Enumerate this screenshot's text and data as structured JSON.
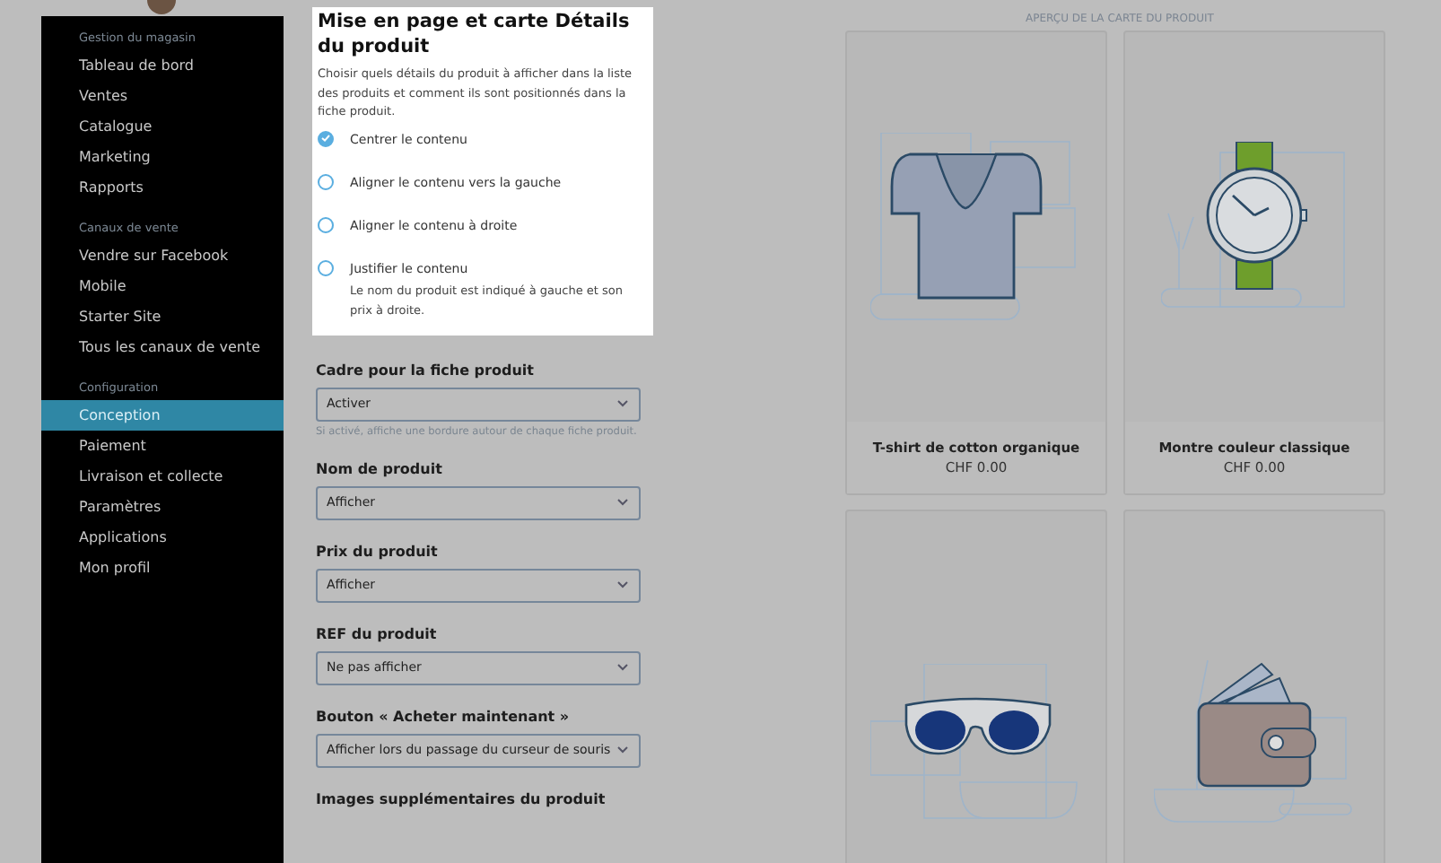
{
  "sidebar": {
    "sections": [
      {
        "heading": "Gestion du magasin",
        "items": [
          {
            "label": "Tableau de bord",
            "selected": false
          },
          {
            "label": "Ventes",
            "selected": false
          },
          {
            "label": "Catalogue",
            "selected": false
          },
          {
            "label": "Marketing",
            "selected": false
          },
          {
            "label": "Rapports",
            "selected": false
          }
        ]
      },
      {
        "heading": "Canaux de vente",
        "items": [
          {
            "label": "Vendre sur Facebook",
            "selected": false
          },
          {
            "label": "Mobile",
            "selected": false
          },
          {
            "label": "Starter Site",
            "selected": false
          },
          {
            "label": "Tous les canaux de vente",
            "selected": false
          }
        ]
      },
      {
        "heading": "Configuration",
        "items": [
          {
            "label": "Conception",
            "selected": true
          },
          {
            "label": "Paiement",
            "selected": false
          },
          {
            "label": "Livraison et collecte",
            "selected": false
          },
          {
            "label": "Paramètres",
            "selected": false
          },
          {
            "label": "Applications",
            "selected": false
          },
          {
            "label": "Mon profil",
            "selected": false
          }
        ]
      }
    ]
  },
  "layout_panel": {
    "title": "Mise en page et carte Détails du produit",
    "description": "Choisir quels détails du produit à afficher dans la liste des produits et comment ils sont positionnés dans la fiche produit.",
    "options": [
      {
        "label": "Centrer le contenu",
        "selected": true
      },
      {
        "label": "Aligner le contenu vers la gauche",
        "selected": false
      },
      {
        "label": "Aligner le contenu à droite",
        "selected": false
      },
      {
        "label": "Justifier le contenu",
        "selected": false,
        "note": "Le nom du produit est indiqué à gauche et son prix à droite."
      }
    ]
  },
  "settings": [
    {
      "label": "Cadre pour la fiche produit",
      "value": "Activer",
      "hint": "Si activé, affiche une bordure autour de chaque fiche produit."
    },
    {
      "label": "Nom de produit",
      "value": "Afficher"
    },
    {
      "label": "Prix du produit",
      "value": "Afficher"
    },
    {
      "label": "REF du produit",
      "value": "Ne pas afficher"
    },
    {
      "label": "Bouton « Acheter maintenant »",
      "value": "Afficher lors du passage du curseur de souris"
    },
    {
      "label": "Images supplémentaires du produit"
    }
  ],
  "preview": {
    "heading": "APERÇU DE LA CARTE DU PRODUIT",
    "cards": [
      {
        "kind": "tshirt",
        "name": "T-shirt de cotton organique",
        "price": "CHF 0.00"
      },
      {
        "kind": "watch",
        "name": "Montre couleur classique",
        "price": "CHF 0.00"
      },
      {
        "kind": "sunglasses"
      },
      {
        "kind": "wallet"
      }
    ]
  }
}
